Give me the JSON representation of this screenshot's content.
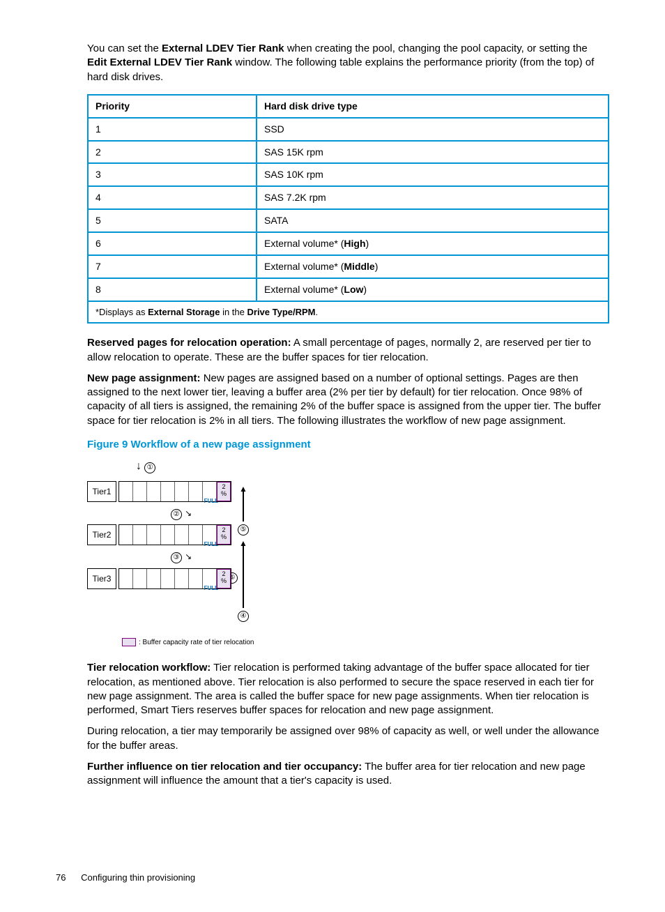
{
  "intro": {
    "p1_a": "You can set the ",
    "p1_b": "External LDEV Tier Rank",
    "p1_c": " when creating the pool, changing the pool capacity, or setting the ",
    "p1_d": "Edit External LDEV Tier Rank",
    "p1_e": " window. The following table explains the performance priority (from the top) of hard disk drives."
  },
  "table": {
    "headers": {
      "c1": "Priority",
      "c2": "Hard disk drive type"
    },
    "rows": [
      {
        "c1": "1",
        "c2": "SSD"
      },
      {
        "c1": "2",
        "c2": "SAS 15K rpm"
      },
      {
        "c1": "3",
        "c2": "SAS 10K rpm"
      },
      {
        "c1": "4",
        "c2": "SAS 7.2K rpm"
      },
      {
        "c1": "5",
        "c2": "SATA"
      },
      {
        "c1": "6",
        "c2_a": "External volume* (",
        "c2_b": "High",
        "c2_c": ")"
      },
      {
        "c1": "7",
        "c2_a": "External volume* (",
        "c2_b": "Middle",
        "c2_c": ")"
      },
      {
        "c1": "8",
        "c2_a": "External volume* (",
        "c2_b": "Low",
        "c2_c": ")"
      }
    ],
    "footnote_a": "*Displays as ",
    "footnote_b": "External Storage",
    "footnote_c": " in the ",
    "footnote_d": "Drive Type/RPM",
    "footnote_e": "."
  },
  "reserved": {
    "label": "Reserved pages for relocation operation:",
    "text": " A small percentage of pages, normally 2, are reserved per tier to allow relocation to operate. These are the buffer spaces for tier relocation."
  },
  "newpage": {
    "label": "New page assignment:",
    "text": " New pages are assigned based on a number of optional settings. Pages are then assigned to the next lower tier, leaving a buffer area (2% per tier by default) for tier relocation. Once 98% of capacity of all tiers is assigned, the remaining 2% of the buffer space is assigned from the upper tier. The buffer space for tier relocation is 2% in all tiers. The following illustrates the workflow of new page assignment."
  },
  "figure": {
    "title": "Figure 9 Workflow of a new page assignment",
    "tiers": {
      "t1": "Tier1",
      "t2": "Tier2",
      "t3": "Tier3"
    },
    "pct_top": "2",
    "pct_bot": "%",
    "full": "FULL",
    "legend": ": Buffer capacity rate of tier relocation",
    "nums": {
      "n1": "①",
      "n2": "②",
      "n3": "③",
      "n4": "④",
      "n5": "⑤",
      "n6": "⑥"
    }
  },
  "tierreloc": {
    "label": "Tier relocation workflow:",
    "text": " Tier relocation is performed taking advantage of the buffer space allocated for tier relocation, as mentioned above. Tier relocation is also performed to secure the space reserved in each tier for new page assignment. The area is called the buffer space for new page assignments. When tier relocation is performed, Smart Tiers reserves buffer spaces for relocation and new page assignment."
  },
  "during": {
    "text": "During relocation, a tier may temporarily be assigned over 98% of capacity as well, or well under the allowance for the buffer areas."
  },
  "further": {
    "label": "Further influence on tier relocation and tier occupancy:",
    "text": " The buffer area for tier relocation and new page assignment will influence the amount that a tier's capacity is used."
  },
  "footer": {
    "page": "76",
    "section": "Configuring thin provisioning"
  }
}
